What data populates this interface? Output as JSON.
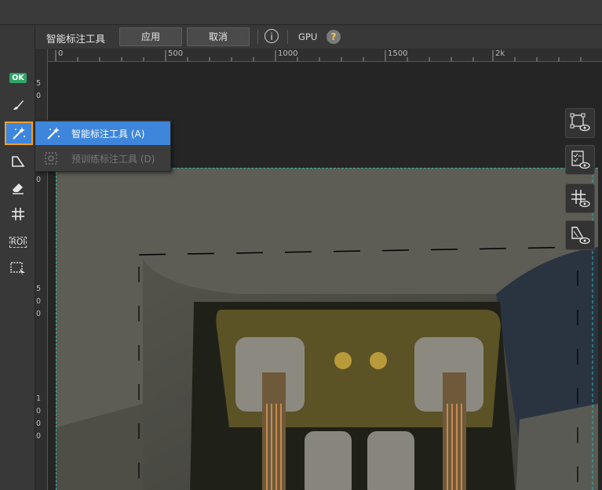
{
  "options_bar": {
    "tool_title": "智能标注工具",
    "apply_label": "应用",
    "cancel_label": "取消",
    "gpu_label": "GPU",
    "help_glyph": "?",
    "info_glyph": "i"
  },
  "ruler_top": {
    "labels": [
      "0",
      "500",
      "1000",
      "1500",
      "2k"
    ]
  },
  "ruler_left": {
    "groups": [
      [
        "5",
        "0"
      ],
      [
        "0"
      ],
      [
        "5",
        "0",
        "0"
      ],
      [
        "1",
        "0",
        "0",
        "0"
      ]
    ]
  },
  "left_toolbar": {
    "ok_label": "OK",
    "roi_label": "ROI",
    "tools": [
      {
        "icon": "ok-check-icon"
      },
      {
        "icon": "brush-icon"
      },
      {
        "icon": "magic-wand-icon",
        "active": true
      },
      {
        "icon": "polygon-icon"
      },
      {
        "icon": "eraser-icon"
      },
      {
        "icon": "grid-hash-icon"
      },
      {
        "icon": "roi-icon"
      },
      {
        "icon": "select-area-icon"
      }
    ]
  },
  "flyout": {
    "items": [
      {
        "label": "智能标注工具 (A)",
        "icon": "magic-wand-icon",
        "selected": true
      },
      {
        "label": "预训练标注工具 (D)",
        "icon": "pretrained-tool-icon",
        "disabled": true
      }
    ]
  },
  "right_panel": {
    "buttons": [
      {
        "icon": "show-boxes-icon"
      },
      {
        "icon": "show-checklist-icon"
      },
      {
        "icon": "show-grid-icon"
      },
      {
        "icon": "show-mask-icon"
      }
    ]
  },
  "colors": {
    "accent_blue": "#3d86dc",
    "highlight_orange": "#f0a12a",
    "ok_green": "#2fa566",
    "dashed_teal": "#2bb5a9"
  }
}
